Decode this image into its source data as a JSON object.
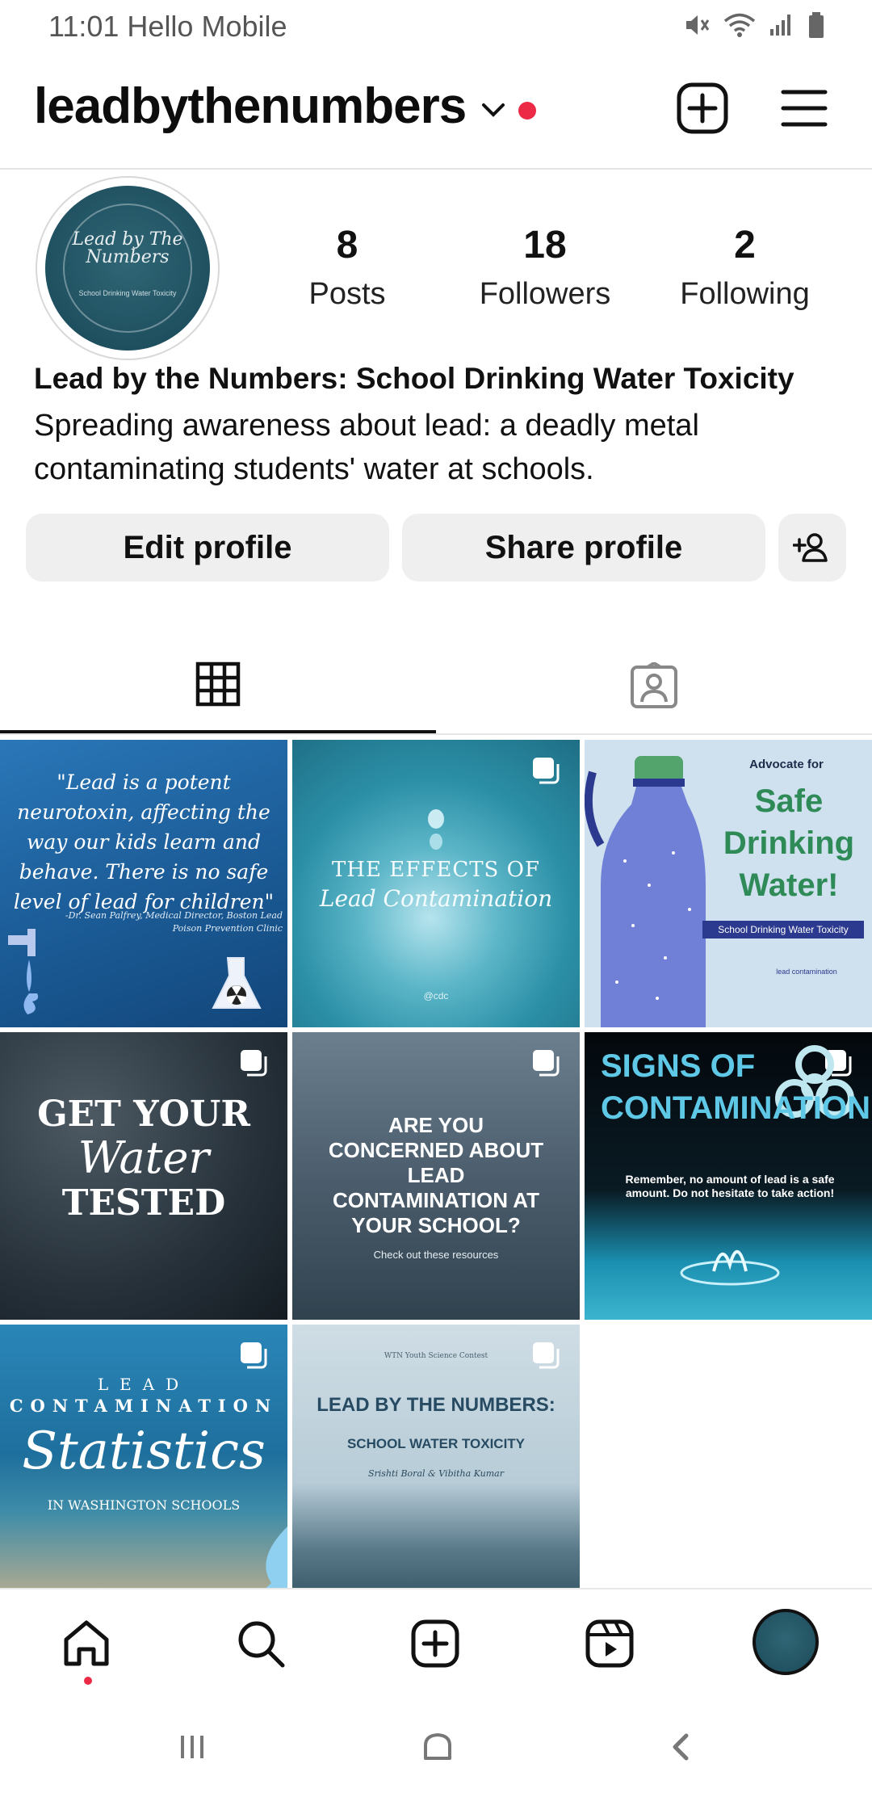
{
  "status_bar": {
    "time_carrier": "11:01 Hello Mobile"
  },
  "top_bar": {
    "username": "leadbythenumbers"
  },
  "profile": {
    "avatar_text_line1": "Lead by The",
    "avatar_text_line2": "Numbers",
    "avatar_subtext": "School Drinking Water Toxicity",
    "stats": [
      {
        "value": "8",
        "label": "Posts"
      },
      {
        "value": "18",
        "label": "Followers"
      },
      {
        "value": "2",
        "label": "Following"
      }
    ],
    "bio_name": "Lead by the Numbers: School Drinking Water Toxicity",
    "bio_text": "Spreading awareness about lead: a deadly metal contaminating students' water at schools.",
    "buttons": {
      "edit": "Edit profile",
      "share": "Share profile"
    }
  },
  "posts": [
    {
      "text": "\"Lead is a potent neurotoxin, affecting the way our kids learn and behave. There is no safe level of lead for children\"",
      "caption": "-Dr. Sean Palfrey, Medical Director, Boston Lead Poison Prevention Clinic",
      "multi": false
    },
    {
      "text": "THE EFFECTS OF",
      "caption": "Lead Contamination",
      "small": "@cdc",
      "multi": true
    },
    {
      "top": "Advocate for",
      "text": "Safe Drinking Water!",
      "caption": "School Drinking Water Toxicity",
      "small": "lead contamination",
      "multi": false
    },
    {
      "text": "GET YOUR",
      "caption": "Water",
      "bottom": "TESTED",
      "multi": true
    },
    {
      "text": "ARE YOU CONCERNED ABOUT LEAD CONTAMINATION AT YOUR SCHOOL?",
      "caption": "Check out these resources",
      "multi": true
    },
    {
      "text": "SIGNS OF CONTAMINATION",
      "caption": "Remember, no amount of lead is a safe amount. Do not hesitate to take action!",
      "multi": true
    },
    {
      "top": "LEAD",
      "text": "CONTAMINATION",
      "caption": "Statistics",
      "bottom": "IN WASHINGTON SCHOOLS",
      "multi": true
    },
    {
      "top": "WTN Youth Science Contest",
      "text": "LEAD BY THE NUMBERS:",
      "caption": "SCHOOL WATER TOXICITY",
      "bottom": "Srishti Boral & Vibitha Kumar",
      "multi": true
    }
  ],
  "colors": {
    "accent_red": "#ed2a45",
    "button_bg": "#efefef",
    "avatar_teal": "#1f5060"
  },
  "icons": {
    "status": [
      "mute-icon",
      "wifi-icon",
      "signal-icon",
      "battery-icon"
    ],
    "top": [
      "chevron-down-icon",
      "new-post-icon",
      "menu-icon"
    ],
    "tabs": [
      "grid-icon",
      "tagged-icon"
    ],
    "nav": [
      "home-icon",
      "search-icon",
      "create-icon",
      "reels-icon",
      "profile-avatar"
    ],
    "system": [
      "recent-apps-icon",
      "home-button-icon",
      "back-icon"
    ]
  }
}
